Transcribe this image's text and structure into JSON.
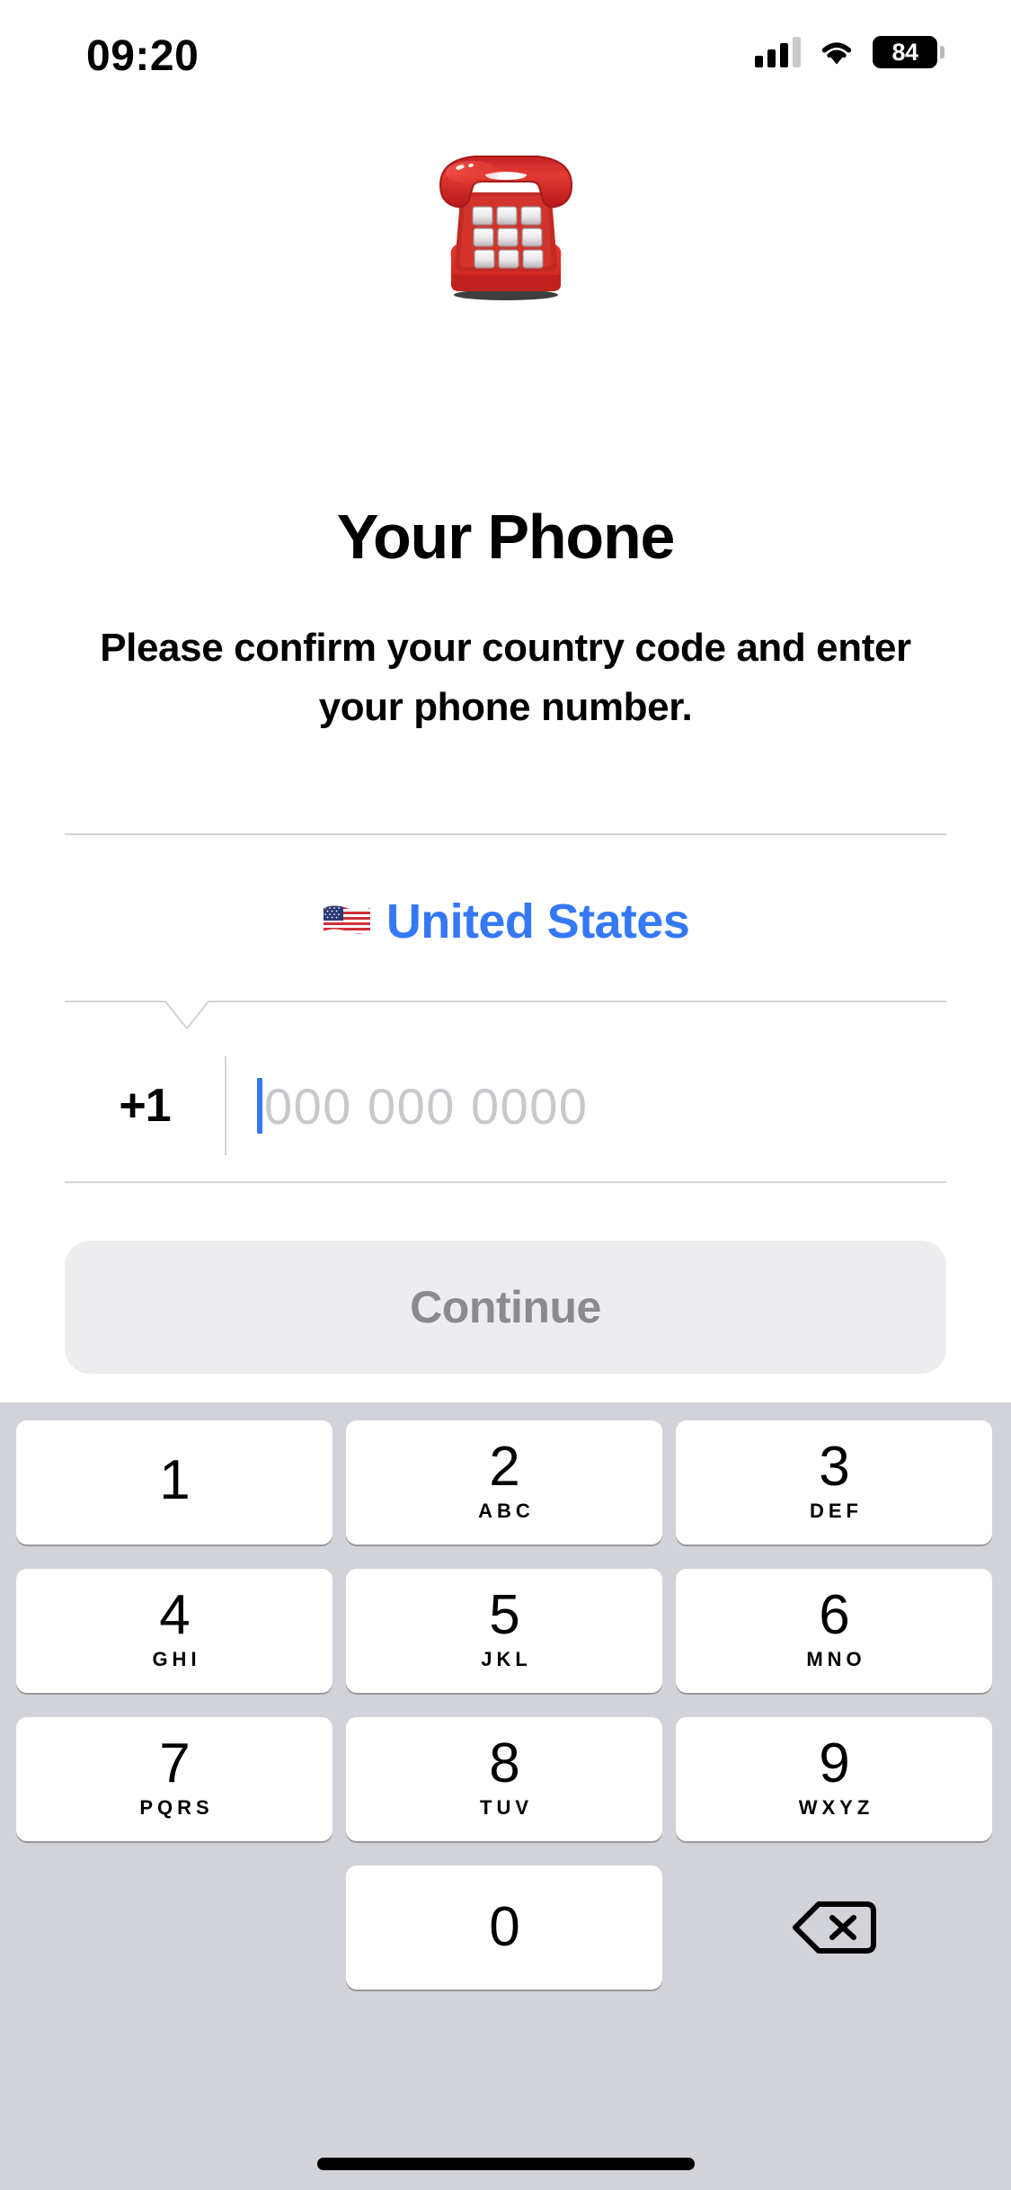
{
  "status_bar": {
    "time": "09:20",
    "battery_level": "84",
    "signal_icon": "cellular-signal-icon",
    "wifi_icon": "wifi-icon",
    "battery_icon": "battery-icon"
  },
  "hero": {
    "emoji": "☎️",
    "emoji_name": "telephone-emoji",
    "title": "Your Phone",
    "subtitle": "Please confirm your country code and enter your phone number."
  },
  "form": {
    "country": {
      "flag": "🇺🇸",
      "flag_name": "us-flag-icon",
      "name": "United States"
    },
    "country_code": "+1",
    "phone_placeholder": "000 000 0000",
    "phone_value": ""
  },
  "actions": {
    "continue_label": "Continue"
  },
  "keypad": {
    "keys": [
      {
        "digit": "1",
        "letters": ""
      },
      {
        "digit": "2",
        "letters": "ABC"
      },
      {
        "digit": "3",
        "letters": "DEF"
      },
      {
        "digit": "4",
        "letters": "GHI"
      },
      {
        "digit": "5",
        "letters": "JKL"
      },
      {
        "digit": "6",
        "letters": "MNO"
      },
      {
        "digit": "7",
        "letters": "PQRS"
      },
      {
        "digit": "8",
        "letters": "TUV"
      },
      {
        "digit": "9",
        "letters": "WXYZ"
      },
      {
        "digit": "0",
        "letters": ""
      }
    ],
    "delete_icon": "delete-backspace-icon"
  },
  "colors": {
    "accent_blue": "#3478F6",
    "keypad_background": "#D1D3D9",
    "key_background": "#FFFFFF",
    "divider": "#D3D3D6",
    "continue_background": "#EDEDEF",
    "continue_text": "#8A8A8F",
    "placeholder_text": "#C7C7CC"
  }
}
